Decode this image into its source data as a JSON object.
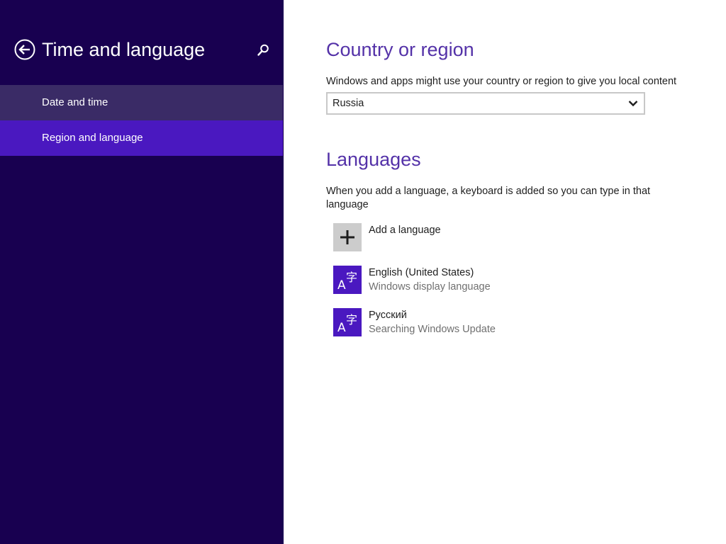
{
  "colors": {
    "left_pane_bg": "#180050",
    "nav_hover_bg": "#3a2b66",
    "nav_selected_bg": "#4a18c0",
    "heading": "#5432a8",
    "language_tile": "#4a18c0",
    "add_tile": "#cccccc"
  },
  "left_pane": {
    "back_icon": "back-arrow-icon",
    "title": "Time and language",
    "search_icon": "search-icon",
    "nav": [
      {
        "label": "Date and time",
        "state": "hover"
      },
      {
        "label": "Region and language",
        "state": "selected"
      }
    ]
  },
  "country_section": {
    "heading": "Country or region",
    "description": "Windows and apps might use your country or region to give you local content",
    "select_value": "Russia",
    "select_icon": "chevron-down-icon"
  },
  "languages_section": {
    "heading": "Languages",
    "description": "When you add a language, a keyboard is added so you can type in that language",
    "add_label": "Add a language",
    "add_icon": "plus-icon",
    "languages": [
      {
        "name": "English (United States)",
        "status": "Windows display language",
        "icon": "language-icon"
      },
      {
        "name": "Русский",
        "status": "Searching Windows Update",
        "icon": "language-icon"
      }
    ]
  }
}
